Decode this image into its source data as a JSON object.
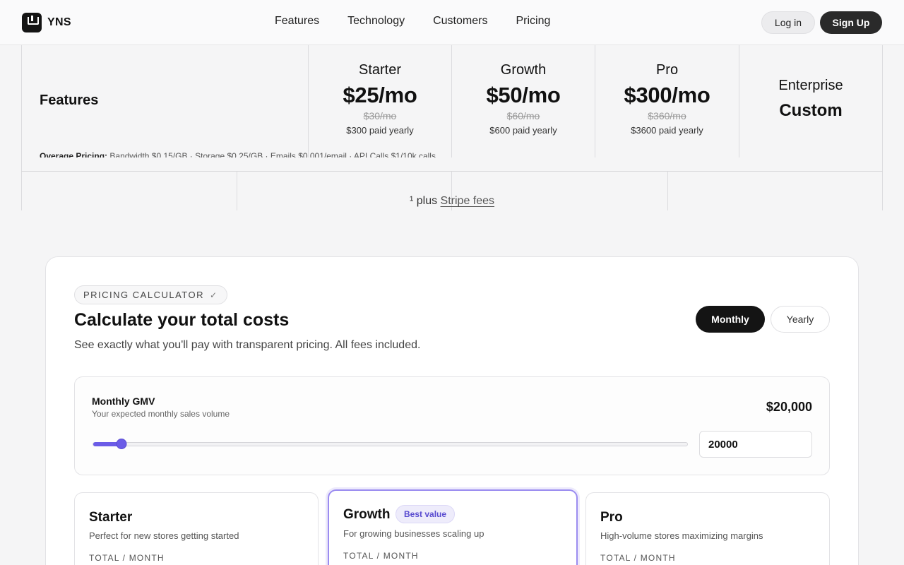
{
  "header": {
    "logo_text": "YNS",
    "nav": [
      "Features",
      "Technology",
      "Customers",
      "Pricing"
    ],
    "login_label": "Log in",
    "signup_label": "Sign Up"
  },
  "pricing_table": {
    "features_label": "Features",
    "plans": [
      {
        "name": "Starter",
        "price": "$25/mo",
        "old_price": "$30/mo",
        "yearly": "$300 paid yearly"
      },
      {
        "name": "Growth",
        "price": "$50/mo",
        "old_price": "$60/mo",
        "yearly": "$600 paid yearly"
      },
      {
        "name": "Pro",
        "price": "$300/mo",
        "old_price": "$360/mo",
        "yearly": "$3600 paid yearly"
      }
    ],
    "enterprise": {
      "name": "Enterprise",
      "price": "Custom"
    },
    "overage_label": "Overage Pricing:",
    "overage_text": "Bandwidth $0.15/GB · Storage $0.25/GB · Emails $0.001/email · API Calls $1/10k calls",
    "stripe_prefix": "¹ plus",
    "stripe_link": "Stripe fees"
  },
  "calculator": {
    "badge": "PRICING CALCULATOR",
    "title": "Calculate your total costs",
    "subtitle": "See exactly what you'll pay with transparent pricing. All fees included.",
    "toggle": {
      "monthly": "Monthly",
      "yearly": "Yearly",
      "selected": "Monthly"
    },
    "gmv": {
      "label": "Monthly GMV",
      "description": "Your expected monthly sales volume",
      "display_value": "$20,000",
      "input_value": "20000",
      "slider_fraction": 0.048
    },
    "plans": [
      {
        "name": "Starter",
        "description": "Perfect for new stores getting started",
        "total_label": "TOTAL / MONTH"
      },
      {
        "name": "Growth",
        "badge": "Best value",
        "description": "For growing businesses scaling up",
        "total_label": "TOTAL / MONTH"
      },
      {
        "name": "Pro",
        "description": "High-volume stores maximizing margins",
        "total_label": "TOTAL / MONTH"
      }
    ]
  },
  "colors": {
    "accent": "#6b5ce7",
    "dark": "#141414",
    "background": "#f5f5f6"
  }
}
